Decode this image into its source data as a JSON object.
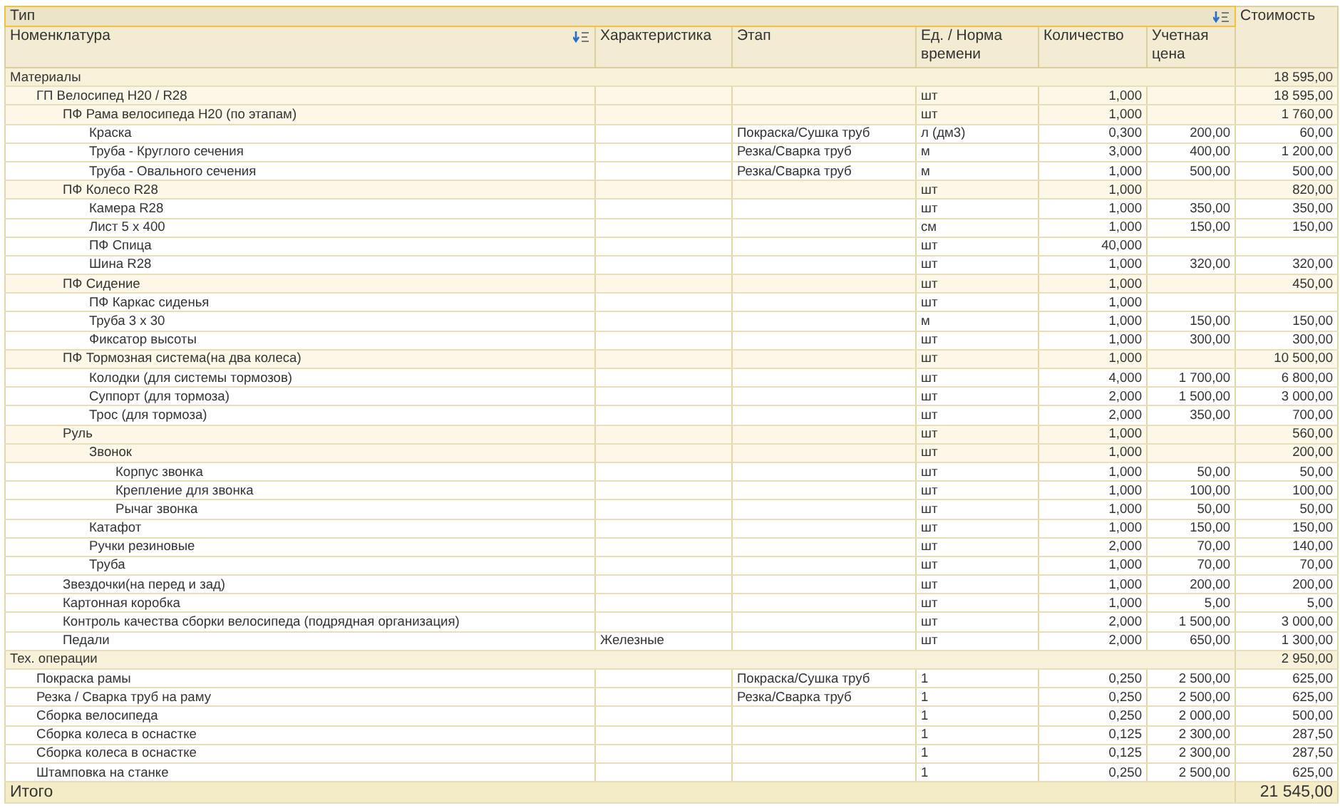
{
  "header": {
    "type_label": "Тип",
    "cost_label": "Стоимость",
    "columns": [
      "Номенклатура",
      "Характеристика",
      "Этап",
      "Ед. / Норма времени",
      "Количество",
      "Учетная цена"
    ]
  },
  "sections": [
    {
      "title": "Материалы",
      "cost": "18 595,00",
      "rows": [
        {
          "name": "ГП Велосипед H20 / R28",
          "unit": "шт",
          "quantity": "1,000",
          "cost": "18 595,00",
          "children": [
            {
              "name": "ПФ Рама велосипеда H20 (по этапам)",
              "unit": "шт",
              "quantity": "1,000",
              "cost": "1 760,00",
              "children": [
                {
                  "name": "Краска",
                  "stage": "Покраска/Сушка труб",
                  "unit": "л (дм3)",
                  "quantity": "0,300",
                  "price": "200,00",
                  "cost": "60,00"
                },
                {
                  "name": "Труба - Круглого сечения",
                  "stage": "Резка/Сварка труб",
                  "unit": "м",
                  "quantity": "3,000",
                  "price": "400,00",
                  "cost": "1 200,00"
                },
                {
                  "name": "Труба - Овального сечения",
                  "stage": "Резка/Сварка труб",
                  "unit": "м",
                  "quantity": "1,000",
                  "price": "500,00",
                  "cost": "500,00"
                }
              ]
            },
            {
              "name": "ПФ Колесо R28",
              "unit": "шт",
              "quantity": "1,000",
              "cost": "820,00",
              "children": [
                {
                  "name": "Камера R28",
                  "unit": "шт",
                  "quantity": "1,000",
                  "price": "350,00",
                  "cost": "350,00"
                },
                {
                  "name": "Лист 5 х 400",
                  "unit": "см",
                  "quantity": "1,000",
                  "price": "150,00",
                  "cost": "150,00"
                },
                {
                  "name": "ПФ Спица",
                  "unit": "шт",
                  "quantity": "40,000"
                },
                {
                  "name": "Шина R28",
                  "unit": "шт",
                  "quantity": "1,000",
                  "price": "320,00",
                  "cost": "320,00"
                }
              ]
            },
            {
              "name": "ПФ Сидение",
              "unit": "шт",
              "quantity": "1,000",
              "cost": "450,00",
              "children": [
                {
                  "name": "ПФ Каркас сиденья",
                  "unit": "шт",
                  "quantity": "1,000"
                },
                {
                  "name": "Труба  3 х 30",
                  "unit": "м",
                  "quantity": "1,000",
                  "price": "150,00",
                  "cost": "150,00"
                },
                {
                  "name": "Фиксатор высоты",
                  "unit": "шт",
                  "quantity": "1,000",
                  "price": "300,00",
                  "cost": "300,00"
                }
              ]
            },
            {
              "name": "ПФ Тормозная система(на два колеса)",
              "unit": "шт",
              "quantity": "1,000",
              "cost": "10 500,00",
              "children": [
                {
                  "name": "Колодки (для системы тормозов)",
                  "unit": "шт",
                  "quantity": "4,000",
                  "price": "1 700,00",
                  "cost": "6 800,00"
                },
                {
                  "name": "Суппорт (для тормоза)",
                  "unit": "шт",
                  "quantity": "2,000",
                  "price": "1 500,00",
                  "cost": "3 000,00"
                },
                {
                  "name": "Трос (для тормоза)",
                  "unit": "шт",
                  "quantity": "2,000",
                  "price": "350,00",
                  "cost": "700,00"
                }
              ]
            },
            {
              "name": "Руль",
              "unit": "шт",
              "quantity": "1,000",
              "cost": "560,00",
              "children": [
                {
                  "name": "Звонок",
                  "unit": "шт",
                  "quantity": "1,000",
                  "cost": "200,00",
                  "children": [
                    {
                      "name": "Корпус звонка",
                      "unit": "шт",
                      "quantity": "1,000",
                      "price": "50,00",
                      "cost": "50,00"
                    },
                    {
                      "name": "Крепление для звонка",
                      "unit": "шт",
                      "quantity": "1,000",
                      "price": "100,00",
                      "cost": "100,00"
                    },
                    {
                      "name": "Рычаг звонка",
                      "unit": "шт",
                      "quantity": "1,000",
                      "price": "50,00",
                      "cost": "50,00"
                    }
                  ]
                },
                {
                  "name": "Катафот",
                  "unit": "шт",
                  "quantity": "1,000",
                  "price": "150,00",
                  "cost": "150,00"
                },
                {
                  "name": "Ручки резиновые",
                  "unit": "шт",
                  "quantity": "2,000",
                  "price": "70,00",
                  "cost": "140,00"
                },
                {
                  "name": "Труба",
                  "unit": "шт",
                  "quantity": "1,000",
                  "price": "70,00",
                  "cost": "70,00"
                }
              ]
            },
            {
              "name": "Звездочки(на перед и зад)",
              "unit": "шт",
              "quantity": "1,000",
              "price": "200,00",
              "cost": "200,00"
            },
            {
              "name": "Картонная коробка",
              "unit": "шт",
              "quantity": "1,000",
              "price": "5,00",
              "cost": "5,00"
            },
            {
              "name": "Контроль качества сборки велосипеда (подрядная организация)",
              "unit": "шт",
              "quantity": "2,000",
              "price": "1 500,00",
              "cost": "3 000,00"
            },
            {
              "name": "Педали",
              "characteristic": "Железные",
              "unit": "шт",
              "quantity": "2,000",
              "price": "650,00",
              "cost": "1 300,00"
            }
          ]
        }
      ]
    },
    {
      "title": "Тех. операции",
      "cost": "2 950,00",
      "rows": [
        {
          "name": "Покраска рамы",
          "stage": "Покраска/Сушка труб",
          "unit": "1",
          "quantity": "0,250",
          "price": "2 500,00",
          "cost": "625,00"
        },
        {
          "name": "Резка / Сварка труб на раму",
          "stage": "Резка/Сварка труб",
          "unit": "1",
          "quantity": "0,250",
          "price": "2 500,00",
          "cost": "625,00"
        },
        {
          "name": "Сборка велосипеда",
          "unit": "1",
          "quantity": "0,250",
          "price": "2 000,00",
          "cost": "500,00"
        },
        {
          "name": "Сборка колеса в оснастке",
          "unit": "1",
          "quantity": "0,125",
          "price": "2 300,00",
          "cost": "287,50"
        },
        {
          "name": "Сборка колеса в оснастке",
          "unit": "1",
          "quantity": "0,125",
          "price": "2 300,00",
          "cost": "287,50"
        },
        {
          "name": "Штамповка на станке",
          "unit": "1",
          "quantity": "0,250",
          "price": "2 500,00",
          "cost": "625,00"
        }
      ]
    }
  ],
  "total": {
    "label": "Итого",
    "cost": "21 545,00"
  }
}
